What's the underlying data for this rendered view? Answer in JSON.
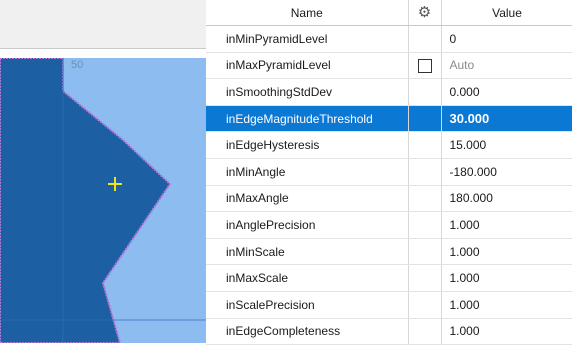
{
  "preview": {
    "tick_label": "50"
  },
  "grid": {
    "headers": {
      "name": "Name",
      "value": "Value",
      "options_icon": "gear-icon"
    },
    "rows": [
      {
        "name": "inMinPyramidLevel",
        "value": "0"
      },
      {
        "name": "inMaxPyramidLevel",
        "value": "Auto",
        "has_checkbox": true,
        "checked": false
      },
      {
        "name": "inSmoothingStdDev",
        "value": "0.000"
      },
      {
        "name": "inEdgeMagnitudeThreshold",
        "value": "30.000",
        "selected": true
      },
      {
        "name": "inEdgeHysteresis",
        "value": "15.000"
      },
      {
        "name": "inMinAngle",
        "value": "-180.000"
      },
      {
        "name": "inMaxAngle",
        "value": "180.000"
      },
      {
        "name": "inAnglePrecision",
        "value": "1.000"
      },
      {
        "name": "inMinScale",
        "value": "1.000"
      },
      {
        "name": "inMaxScale",
        "value": "1.000"
      },
      {
        "name": "inScalePrecision",
        "value": "1.000"
      },
      {
        "name": "inEdgeCompleteness",
        "value": "1.000"
      }
    ]
  },
  "colors": {
    "selection": "#0b78d3",
    "image_light": "#8dbcf0",
    "image_dark": "#1c5fa2",
    "crosshair": "#f2e21a",
    "edge": "#b77ad6"
  }
}
